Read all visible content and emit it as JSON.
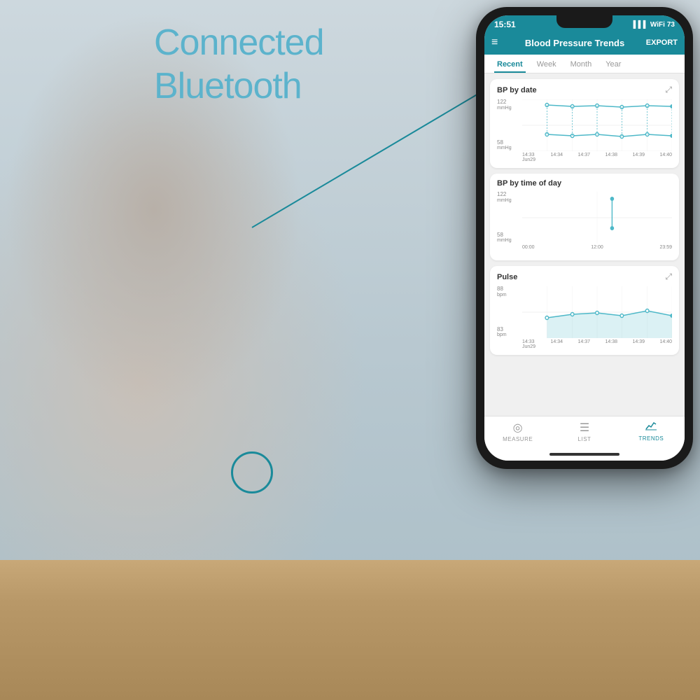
{
  "background": {
    "text_connected": "Connected",
    "text_bluetooth": "Bluetooth",
    "text_color": "#5cb3cc"
  },
  "phone": {
    "status_bar": {
      "time": "15:51",
      "battery": "73",
      "signal": "●●●",
      "wifi": "wifi"
    },
    "header": {
      "menu_icon": "≡",
      "title": "Blood Pressure Trends",
      "export_label": "EXPORT"
    },
    "tabs": [
      {
        "label": "Recent",
        "active": true
      },
      {
        "label": "Week",
        "active": false
      },
      {
        "label": "Month",
        "active": false
      },
      {
        "label": "Year",
        "active": false
      }
    ],
    "charts": [
      {
        "title": "BP by date",
        "has_expand": true,
        "y_top_label": "122",
        "y_top_unit": "mmHg",
        "y_bottom_label": "58",
        "y_bottom_unit": "mmHg",
        "x_labels": [
          "14:33\nJun29",
          "14:34",
          "14:37",
          "14:38",
          "14:39",
          "14:40"
        ],
        "type": "bp_date"
      },
      {
        "title": "BP by time of day",
        "has_expand": false,
        "y_top_label": "122",
        "y_top_unit": "mmHg",
        "y_bottom_label": "58",
        "y_bottom_unit": "mmHg",
        "x_labels": [
          "00:00",
          "12:00",
          "23:59"
        ],
        "type": "bp_time"
      },
      {
        "title": "Pulse",
        "has_expand": true,
        "y_top_label": "88",
        "y_top_unit": "bpm",
        "y_bottom_label": "83",
        "y_bottom_unit": "bpm",
        "x_labels": [
          "14:33\nJun29",
          "14:34",
          "14:37",
          "14:38",
          "14:39",
          "14:40"
        ],
        "type": "pulse"
      }
    ],
    "bottom_nav": [
      {
        "label": "MEASURE",
        "icon": "◎",
        "active": false
      },
      {
        "label": "LIST",
        "icon": "≡",
        "active": false
      },
      {
        "label": "TRENDS",
        "icon": "📈",
        "active": true
      }
    ]
  }
}
